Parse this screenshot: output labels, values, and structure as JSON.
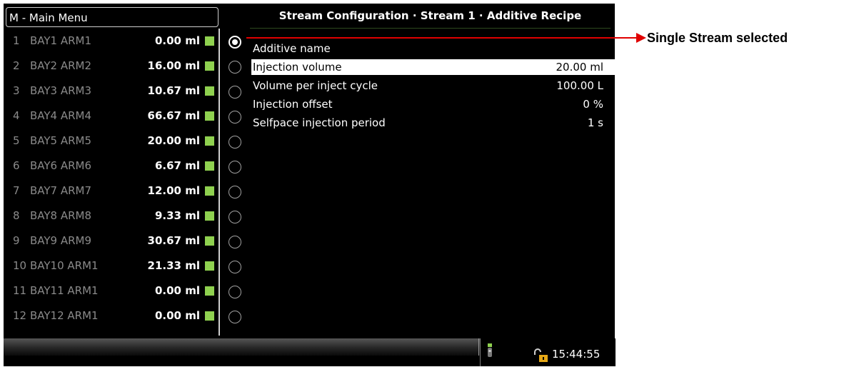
{
  "menu": {
    "title": "M - Main Menu"
  },
  "arms": [
    {
      "num": "1",
      "name": "BAY1 ARM1",
      "volume": "0.00 ml"
    },
    {
      "num": "2",
      "name": "BAY2 ARM2",
      "volume": "16.00 ml"
    },
    {
      "num": "3",
      "name": "BAY3 ARM3",
      "volume": "10.67 ml"
    },
    {
      "num": "4",
      "name": "BAY4 ARM4",
      "volume": "66.67 ml"
    },
    {
      "num": "5",
      "name": "BAY5 ARM5",
      "volume": "20.00 ml"
    },
    {
      "num": "6",
      "name": "BAY6 ARM6",
      "volume": "6.67 ml"
    },
    {
      "num": "7",
      "name": "BAY7 ARM7",
      "volume": "12.00 ml"
    },
    {
      "num": "8",
      "name": "BAY8 ARM8",
      "volume": "9.33 ml"
    },
    {
      "num": "9",
      "name": "BAY9 ARM9",
      "volume": "30.67 ml"
    },
    {
      "num": "10",
      "name": "BAY10 ARM1",
      "volume": "21.33 ml"
    },
    {
      "num": "11",
      "name": "BAY11 ARM1",
      "volume": "0.00 ml"
    },
    {
      "num": "12",
      "name": "BAY12 ARM1",
      "volume": "0.00 ml"
    }
  ],
  "selected_stream_index": 0,
  "config": {
    "title": "Stream Configuration · Stream 1 · Additive Recipe",
    "params": [
      {
        "label": "Additive name",
        "value": ""
      },
      {
        "label": "Injection volume",
        "value": "20.00 ml"
      },
      {
        "label": "Volume per inject cycle",
        "value": "100.00 L"
      },
      {
        "label": "Injection offset",
        "value": "0 %"
      },
      {
        "label": "Selfpace injection period",
        "value": "1 s"
      }
    ],
    "active_param_index": 1
  },
  "status": {
    "clock": "15:44:55",
    "icons": [
      "device-icon",
      "unlocked-padlock-icon"
    ]
  },
  "annotation": {
    "text": "Single Stream selected",
    "color": "#e00000"
  },
  "colors": {
    "led": "#8fd14f",
    "screen_bg": "#000000",
    "accent": "#e00000",
    "lock": "#e6a817"
  }
}
